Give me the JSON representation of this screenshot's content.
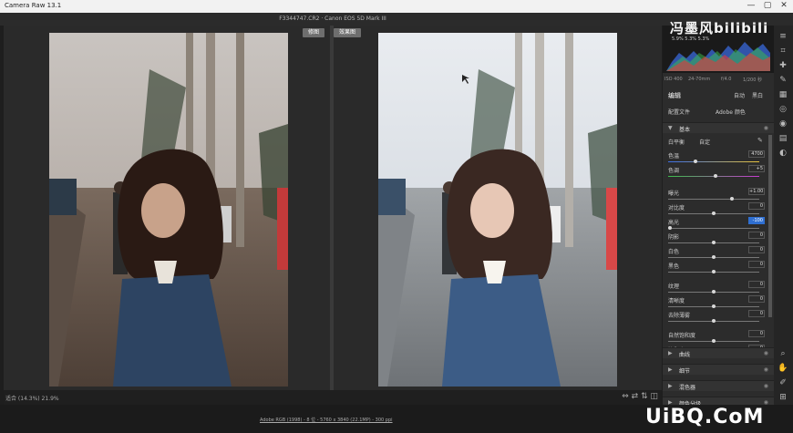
{
  "window": {
    "title": "Camera Raw 13.1",
    "minimize": "—",
    "maximize": "▢",
    "close": "✕"
  },
  "topbar": {
    "filename": "F3344747.CR2  ·  Canon EOS 5D Mark III"
  },
  "view": {
    "before_label": "修图",
    "after_label": "效果图"
  },
  "watermark": {
    "text": "冯墨风bilibili"
  },
  "histogram": {
    "readout": "5.9%   5.3%   5.3%",
    "colors": {
      "red": "#e23b3b",
      "green": "#3bbf4a",
      "blue": "#3a6ee8"
    }
  },
  "camera_info": {
    "iso": "ISO 400",
    "lens": "24-70mm",
    "aperture": "f/4.0",
    "shutter": "1/200 秒"
  },
  "panel": {
    "edit_label": "编辑",
    "auto_label": "自动",
    "bw_label": "黑白",
    "profile_label": "配置文件",
    "profile_value": "Adobe 颜色",
    "basic_section": "基本",
    "wb_label": "白平衡",
    "wb_value": "自定",
    "sliders": [
      {
        "label": "色温",
        "value": "4700",
        "pos": 0.3,
        "highlight": false
      },
      {
        "label": "色调",
        "value": "+5",
        "pos": 0.52,
        "highlight": false
      },
      {
        "label": "曝光",
        "value": "+1.00",
        "pos": 0.7,
        "highlight": false
      },
      {
        "label": "对比度",
        "value": "0",
        "pos": 0.5,
        "highlight": false
      },
      {
        "label": "高光",
        "value": "-100",
        "pos": 0.02,
        "highlight": true
      },
      {
        "label": "阴影",
        "value": "0",
        "pos": 0.5,
        "highlight": false
      },
      {
        "label": "白色",
        "value": "0",
        "pos": 0.5,
        "highlight": false
      },
      {
        "label": "黑色",
        "value": "0",
        "pos": 0.5,
        "highlight": false
      },
      {
        "label": "纹理",
        "value": "0",
        "pos": 0.5,
        "highlight": false
      },
      {
        "label": "清晰度",
        "value": "0",
        "pos": 0.5,
        "highlight": false
      },
      {
        "label": "去除薄雾",
        "value": "0",
        "pos": 0.5,
        "highlight": false
      },
      {
        "label": "自然饱和度",
        "value": "0",
        "pos": 0.5,
        "highlight": false
      },
      {
        "label": "饱和度",
        "value": "0",
        "pos": 0.5,
        "highlight": false
      }
    ],
    "collapsed_sections": [
      "曲线",
      "细节",
      "混色器",
      "颜色分级"
    ]
  },
  "bottom": {
    "zoom": "适合 (14.3%)   21.9%"
  },
  "footer": {
    "workflow": "Adobe RGB (1998) - 8 位 - 5760 x 3840 (22.1MP) - 300 ppi"
  },
  "logo": {
    "text": "UiBQ.CoM"
  }
}
